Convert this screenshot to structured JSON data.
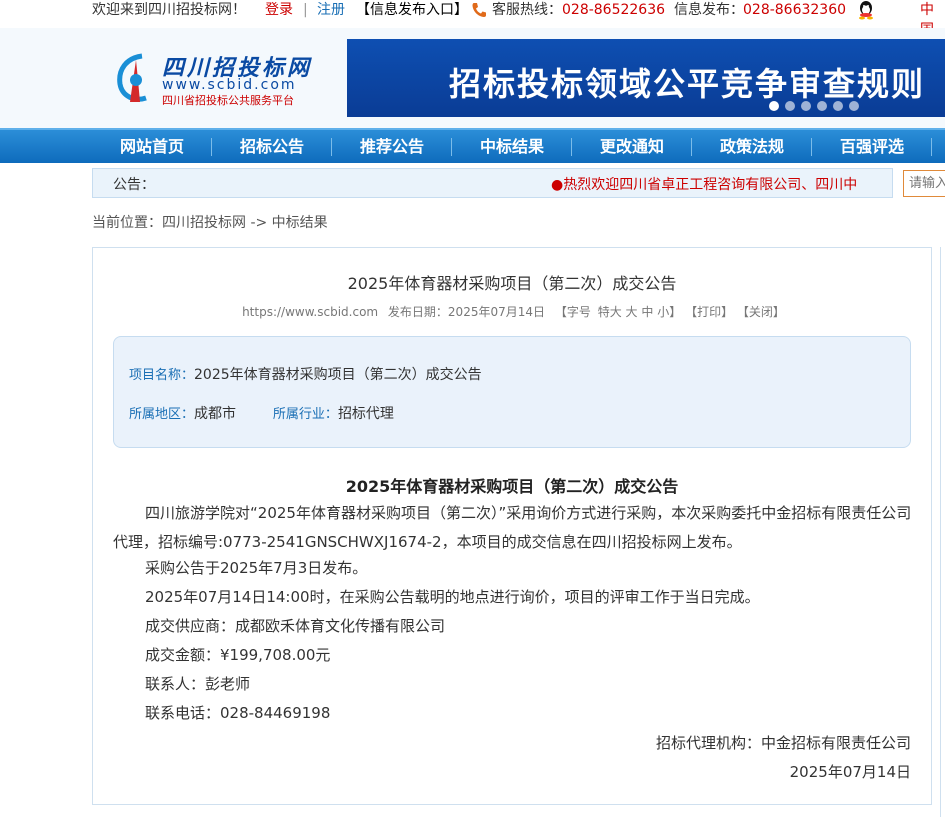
{
  "topbar": {
    "welcome": "欢迎来到四川招投标网！",
    "login": "登录",
    "separator": "|",
    "register": "注册",
    "publish_entry": "【信息发布入口】",
    "hotline_label": "客服热线：",
    "hotline": "028-86522636",
    "info_label": "信息发布：",
    "info_phone": "028-86632360",
    "cn": "中国"
  },
  "logo": {
    "title": "四川招投标网",
    "url": "www.scbid.com",
    "subtitle": "四川省招投标公共服务平台"
  },
  "banner": {
    "text": "招标投标领域公平竞争审查规则",
    "dots": 6,
    "active_dot": 1
  },
  "nav": {
    "items": [
      "网站首页",
      "招标公告",
      "推荐公告",
      "中标结果",
      "更改通知",
      "政策法规",
      "百强评选"
    ]
  },
  "notice": {
    "label": "公告：",
    "text": "●热烈欢迎四川省卓正工程咨询有限公司、四川中"
  },
  "search": {
    "placeholder": "请输入"
  },
  "breadcrumb": "当前位置：四川招投标网 -> 中标结果",
  "article": {
    "title": "2025年体育器材采购项目（第二次）成交公告",
    "meta": {
      "site": "https://www.scbid.com",
      "date_label": "发布日期：2025年07月14日",
      "font_label": "【字号",
      "font_xl": "特大",
      "font_l": "大",
      "font_m": "中",
      "font_s": "小】",
      "print": "【打印】",
      "close": "【关闭】"
    },
    "info": {
      "project_key": "项目名称：",
      "project_value": "2025年体育器材采购项目（第二次）成交公告",
      "region_key": "所属地区：",
      "region_value": "成都市",
      "industry_key": "所属行业：",
      "industry_value": "招标代理"
    },
    "content_title": "2025年体育器材采购项目（第二次）成交公告",
    "para1": "四川旅游学院对“2025年体育器材采购项目（第二次）”采用询价方式进行采购，本次采购委托中金招标有限责任公司代理，招标编号:0773-2541GNSCHWXJ1674-2，本项目的成交信息在四川招投标网上发布。",
    "line_publish": "采购公告于2025年7月3日发布。",
    "line_review": "2025年07月14日14:00时，在采购公告载明的地点进行询价，项目的评审工作于当日完成。",
    "line_supplier": "成交供应商：成都欧禾体育文化传播有限公司",
    "line_amount": "成交金额：¥199,708.00元",
    "line_contact": "联系人：彭老师",
    "line_phone": "联系电话：028-84469198",
    "agency": "招标代理机构：中金招标有限责任公司",
    "sign_date": "2025年07月14日"
  },
  "colors": {
    "brand_blue": "#0e6bbc",
    "accent_red": "#cc0000",
    "link_blue": "#1a6fb5"
  }
}
